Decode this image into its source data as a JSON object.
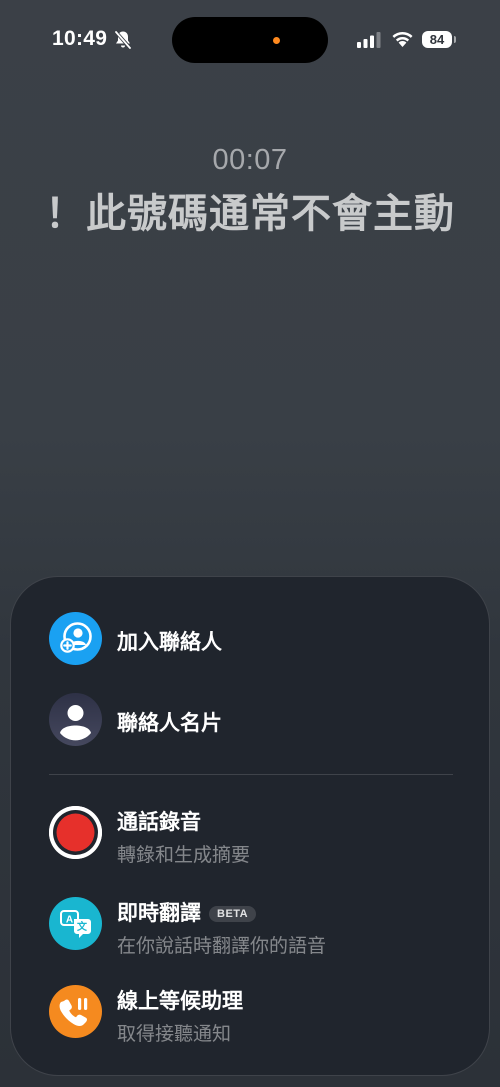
{
  "status_bar": {
    "time": "10:49",
    "battery": "84",
    "island_indicator_color": "#ff8a1f"
  },
  "call": {
    "timer": "00:07",
    "caller_label": "！此號碼通常不會主動"
  },
  "menu": {
    "primary": [
      {
        "label": "加入聯絡人",
        "icon": "add-contact-icon",
        "color": "#1aa1f2"
      },
      {
        "label": "聯絡人名片",
        "icon": "contact-card-icon",
        "color": "#3d3f55"
      }
    ],
    "features": [
      {
        "label": "通話錄音",
        "subtitle": "轉錄和生成摘要",
        "icon": "record-icon",
        "color": "#e6302b"
      },
      {
        "label": "即時翻譯",
        "badge": "BETA",
        "subtitle": "在你說話時翻譯你的語音",
        "icon": "translate-icon",
        "color": "#19b6d0"
      },
      {
        "label": "線上等候助理",
        "subtitle": "取得接聽通知",
        "icon": "hold-assist-icon",
        "color": "#f58a1f"
      }
    ]
  }
}
